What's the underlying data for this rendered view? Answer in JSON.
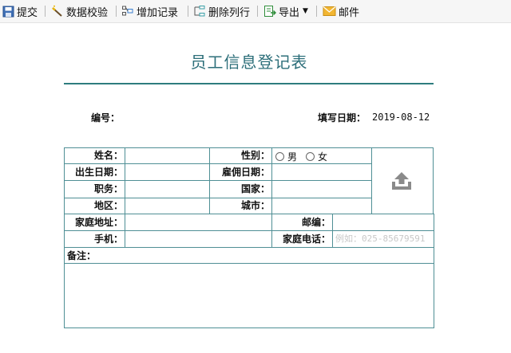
{
  "toolbar": {
    "submit_label": "提交",
    "validate_label": "数据校验",
    "add_record_label": "增加记录",
    "delete_row_label": "删除列行",
    "export_label": "导出",
    "mail_label": "邮件"
  },
  "icons": {
    "submit": "save-icon",
    "validate": "wand-icon",
    "add_record": "add-row-icon",
    "delete_row": "delete-row-icon",
    "export": "export-icon",
    "mail": "envelope-icon",
    "photo_upload": "upload-icon"
  },
  "form": {
    "title": "员工信息登记表",
    "number_label": "编号：",
    "fill_date_label": "填写日期：",
    "fill_date_value": "2019-08-12",
    "fields": {
      "name": "姓名：",
      "gender": "性别：",
      "birth_date": "出生日期：",
      "hire_date": "雇佣日期：",
      "position": "职务：",
      "country": "国家：",
      "region": "地区：",
      "city": "城市：",
      "home_address": "家庭地址：",
      "postcode": "邮编：",
      "mobile": "手机：",
      "home_phone": "家庭电话：",
      "remarks": "备注："
    },
    "gender_options": [
      "男",
      "女"
    ],
    "home_phone_placeholder": "例如：025-85679591"
  },
  "colors": {
    "title": "#2d6f7a",
    "rule": "#2e7c7e",
    "border": "#4f8f95",
    "upload_icon": "#8a8a8a"
  }
}
